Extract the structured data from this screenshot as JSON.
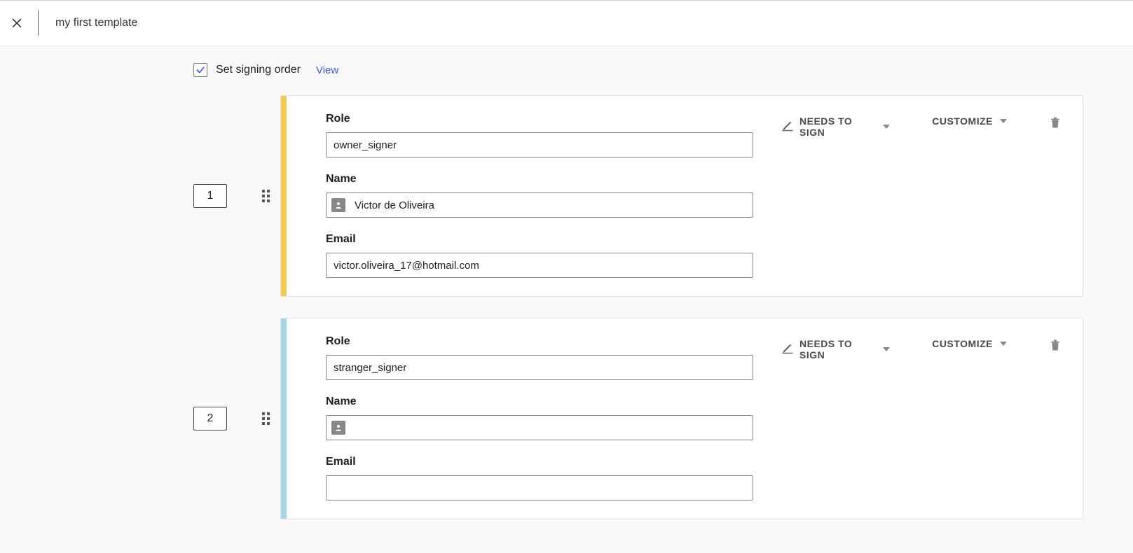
{
  "header": {
    "title": "my first template"
  },
  "signing_order": {
    "checked": true,
    "label": "Set signing order",
    "view_link": "View"
  },
  "labels": {
    "role": "Role",
    "name": "Name",
    "email": "Email",
    "needs_to_sign": "NEEDS TO SIGN",
    "customize": "CUSTOMIZE"
  },
  "recipients": [
    {
      "order": "1",
      "color": "#f2c94c",
      "role": "owner_signer",
      "name": "Victor de Oliveira",
      "email": "victor.oliveira_17@hotmail.com"
    },
    {
      "order": "2",
      "color": "#a6d6e7",
      "role": "stranger_signer",
      "name": "",
      "email": ""
    }
  ]
}
